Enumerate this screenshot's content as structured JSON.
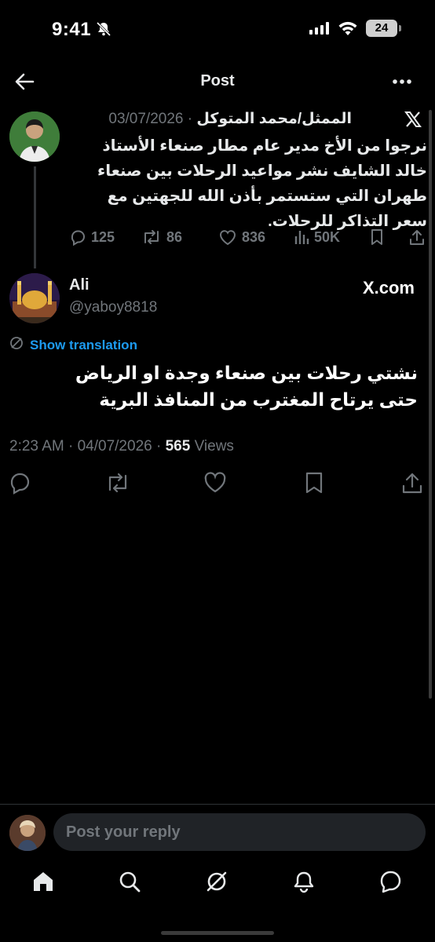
{
  "status_bar": {
    "time": "9:41",
    "battery": "24"
  },
  "header": {
    "title": "Post"
  },
  "parent_post": {
    "author": "الممثل/محمد المتوكل",
    "separator": "·",
    "date": "03/07/2026",
    "text": "نرجوا من الأخ مدير عام مطار صنعاء الأستاذ خالد الشايف نشر مواعيد الرحلات بين صنعاء طهران التي ستستمر بأذن الله للجهتين مع سعر التذاكر للرحلات.",
    "stats": {
      "replies": "125",
      "reposts": "86",
      "likes": "836",
      "views": "50K"
    }
  },
  "post": {
    "name": "Ali",
    "handle": "@yaboy8818",
    "source": "X.com",
    "translate_label": "Show translation",
    "text": "نشتي رحلات بين صنعاء  وجدة  او الرياض\nحتى يرتاح المغترب من المنافذ البرية",
    "time": "2:23 AM",
    "date": "04/07/2026",
    "views_count": "565",
    "views_label": "Views",
    "dot": "·"
  },
  "reply": {
    "placeholder": "Post your reply"
  },
  "colors": {
    "background": "#000000",
    "accent": "#1d9bf0",
    "muted": "#71767b",
    "text": "#e7e9ea"
  },
  "icons": {
    "bottom_nav": [
      "home-icon",
      "search-icon",
      "grok-icon",
      "notifications-icon",
      "messages-icon"
    ],
    "post_actions": [
      "reply-icon",
      "repost-icon",
      "like-icon",
      "bookmark-icon",
      "share-icon"
    ]
  }
}
